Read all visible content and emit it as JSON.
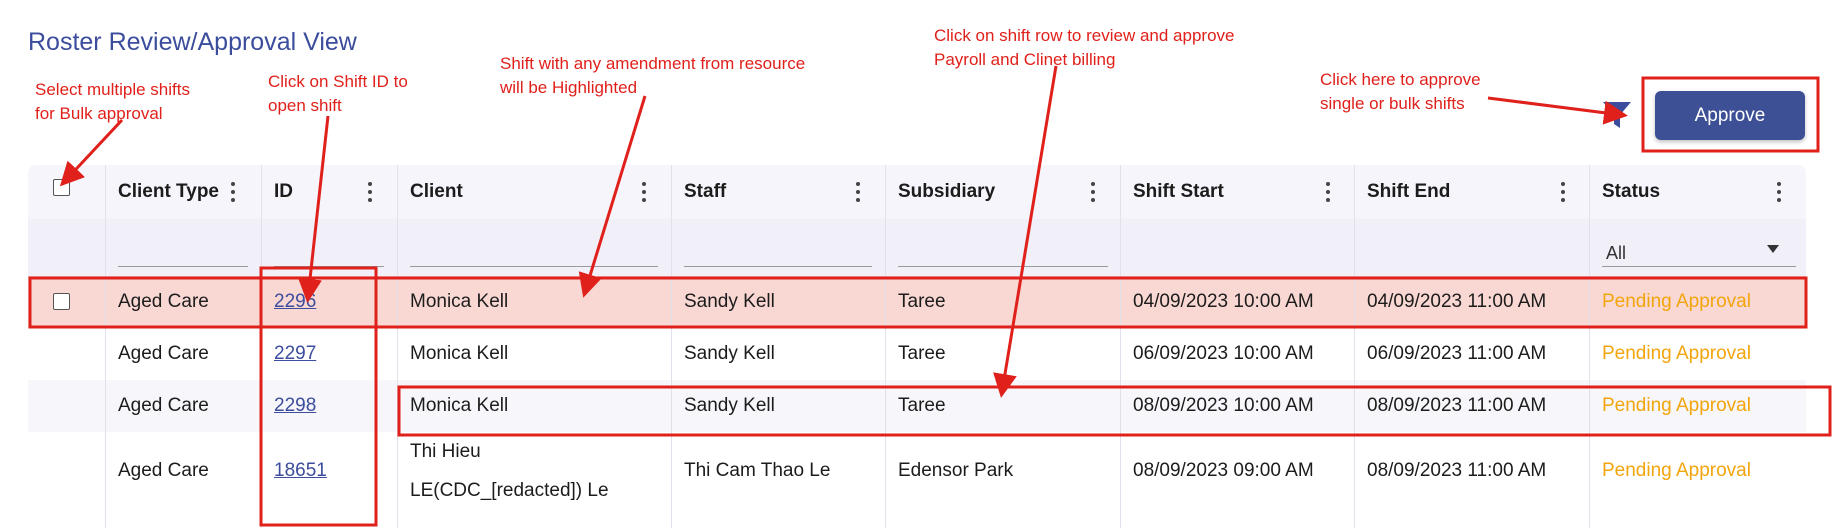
{
  "page": {
    "title": "Roster Review/Approval View",
    "approve_label": "Approve"
  },
  "columns": [
    "Client Type",
    "ID",
    "Client",
    "Staff",
    "Subsidiary",
    "Shift Start",
    "Shift End",
    "Status"
  ],
  "status_filter": "All",
  "rows": [
    {
      "client_type": "Aged Care",
      "id": "2296",
      "client": "Monica Kell",
      "staff": "Sandy Kell",
      "subsidiary": "Taree",
      "shift_start": "04/09/2023 10:00 AM",
      "shift_end": "04/09/2023 11:00 AM",
      "status": "Pending Approval"
    },
    {
      "client_type": "Aged Care",
      "id": "2297",
      "client": "Monica Kell",
      "staff": "Sandy Kell",
      "subsidiary": "Taree",
      "shift_start": "06/09/2023 10:00 AM",
      "shift_end": "06/09/2023 11:00 AM",
      "status": "Pending Approval"
    },
    {
      "client_type": "Aged Care",
      "id": "2298",
      "client": "Monica Kell",
      "staff": "Sandy Kell",
      "subsidiary": "Taree",
      "shift_start": "08/09/2023 10:00 AM",
      "shift_end": "08/09/2023 11:00 AM",
      "status": "Pending Approval"
    },
    {
      "client_type": "Aged Care",
      "id": "18651",
      "client_line1": "Thi Hieu",
      "client_line2": "LE(CDC_[redacted]) Le",
      "staff": "Thi Cam Thao Le",
      "subsidiary": "Edensor Park",
      "shift_start": "08/09/2023 09:00 AM",
      "shift_end": "08/09/2023 11:00 AM",
      "status": "Pending Approval"
    }
  ],
  "annotations": {
    "bulk_select": [
      "Select multiple shifts",
      "for Bulk approval"
    ],
    "shift_id": [
      "Click on Shift ID to",
      "open shift"
    ],
    "amendment": [
      "Shift with any amendment from resource",
      "will be Highlighted"
    ],
    "review_row": [
      "Click on shift row to review and approve",
      "Payroll and Clinet billing"
    ],
    "approve_hint": [
      "Click here to approve",
      "single or bulk shifts"
    ]
  },
  "colors": {
    "accent": "#3b4d9c",
    "approve_button": "#3d4f95",
    "annotation": "#e0201b",
    "status_pending": "#f2a50c",
    "highlight_row": "#f9d8d3"
  },
  "icons": [
    "filter-icon",
    "kebab-menu-icon",
    "dropdown-arrow-icon",
    "checkbox"
  ]
}
